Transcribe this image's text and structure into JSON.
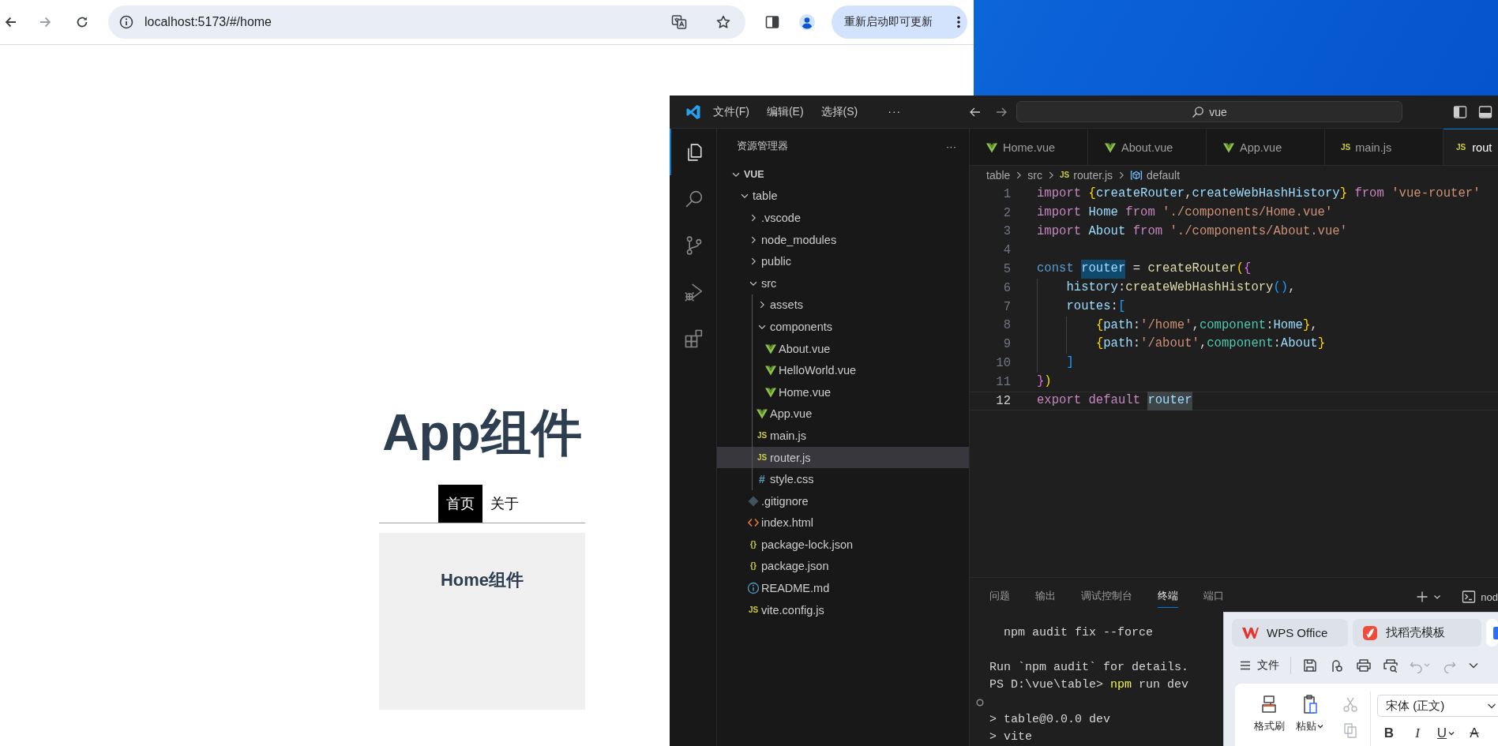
{
  "browser": {
    "url": "localhost:5173/#/home",
    "update_button": "重新启动即可更新",
    "page": {
      "heading": "App组件",
      "nav": [
        {
          "label": "首页",
          "selected": true
        },
        {
          "label": "关于",
          "selected": false
        }
      ],
      "view_title": "Home组件"
    }
  },
  "editor_window": {
    "menu": [
      "文件(F)",
      "编辑(E)",
      "选择(S)",
      "···"
    ],
    "search": "vue",
    "activity_bar": [
      {
        "kind": "explorer",
        "selected": true
      },
      {
        "kind": "search",
        "selected": false
      },
      {
        "kind": "source-control",
        "selected": false
      },
      {
        "kind": "run-debug",
        "selected": false
      },
      {
        "kind": "extensions",
        "selected": false
      }
    ],
    "explorer": {
      "title": "资源管理器",
      "more": "···",
      "tree": [
        {
          "label": "VUE",
          "kind": "folder",
          "expanded": true,
          "selected": false,
          "children": [
            {
              "label": "table",
              "kind": "folder",
              "expanded": true,
              "selected": false,
              "children": [
                {
                  "label": ".vscode",
                  "kind": "folder",
                  "expanded": false,
                  "selected": false
                },
                {
                  "label": "node_modules",
                  "kind": "folder",
                  "expanded": false,
                  "selected": false
                },
                {
                  "label": "public",
                  "kind": "folder",
                  "expanded": false,
                  "selected": false
                },
                {
                  "label": "src",
                  "kind": "folder",
                  "expanded": true,
                  "selected": false,
                  "children": [
                    {
                      "label": "assets",
                      "kind": "folder",
                      "expanded": false,
                      "selected": false
                    },
                    {
                      "label": "components",
                      "kind": "folder",
                      "expanded": true,
                      "selected": false,
                      "children": [
                        {
                          "label": "About.vue",
                          "kind": "vue",
                          "selected": false
                        },
                        {
                          "label": "HelloWorld.vue",
                          "kind": "vue",
                          "selected": false
                        },
                        {
                          "label": "Home.vue",
                          "kind": "vue",
                          "selected": false
                        }
                      ]
                    },
                    {
                      "label": "App.vue",
                      "kind": "vue",
                      "selected": false
                    },
                    {
                      "label": "main.js",
                      "kind": "js",
                      "icon_text": "JS",
                      "selected": false
                    },
                    {
                      "label": "router.js",
                      "kind": "js",
                      "icon_text": "JS",
                      "selected": true
                    },
                    {
                      "label": "style.css",
                      "kind": "css",
                      "icon_text": "#",
                      "selected": false
                    }
                  ]
                },
                {
                  "label": ".gitignore",
                  "kind": "git",
                  "selected": false
                },
                {
                  "label": "index.html",
                  "kind": "html",
                  "selected": false
                },
                {
                  "label": "package-lock.json",
                  "kind": "json",
                  "icon_text": "{}",
                  "selected": false
                },
                {
                  "label": "package.json",
                  "kind": "json",
                  "icon_text": "{}",
                  "selected": false
                },
                {
                  "label": "README.md",
                  "kind": "info",
                  "selected": false
                },
                {
                  "label": "vite.config.js",
                  "kind": "js",
                  "icon_text": "JS",
                  "selected": false
                }
              ]
            }
          ]
        }
      ]
    },
    "tabs": [
      {
        "label": "Home.vue",
        "kind": "vue",
        "selected": false
      },
      {
        "label": "About.vue",
        "kind": "vue",
        "selected": false
      },
      {
        "label": "App.vue",
        "kind": "vue",
        "selected": false
      },
      {
        "label": "main.js",
        "kind": "js",
        "icon_text": "JS",
        "selected": false
      },
      {
        "label": "rout",
        "kind": "js",
        "icon_text": "JS",
        "selected": true
      }
    ],
    "breadcrumb": [
      {
        "label": "table",
        "kind": "folder"
      },
      {
        "label": "src",
        "kind": "folder"
      },
      {
        "label": "router.js",
        "kind": "js",
        "icon_text": "JS"
      },
      {
        "label": "default",
        "kind": "symbol"
      }
    ],
    "code": [
      {
        "number": "1",
        "current": false,
        "tokens": [
          {
            "text": "import ",
            "kind": "kw"
          },
          {
            "text": "{",
            "kind": "b1"
          },
          {
            "text": "createRouter",
            "kind": "var"
          },
          {
            "text": ",",
            "kind": "p"
          },
          {
            "text": "createWebHashHistory",
            "kind": "var"
          },
          {
            "text": "} ",
            "kind": "b1"
          },
          {
            "text": "from ",
            "kind": "kw"
          },
          {
            "text": "'vue-router'",
            "kind": "str"
          }
        ]
      },
      {
        "number": "2",
        "current": false,
        "tokens": [
          {
            "text": "import ",
            "kind": "kw"
          },
          {
            "text": "Home ",
            "kind": "var"
          },
          {
            "text": "from ",
            "kind": "kw"
          },
          {
            "text": "'./components/Home.vue'",
            "kind": "str"
          }
        ]
      },
      {
        "number": "3",
        "current": false,
        "tokens": [
          {
            "text": "import ",
            "kind": "kw"
          },
          {
            "text": "About ",
            "kind": "var"
          },
          {
            "text": "from ",
            "kind": "kw"
          },
          {
            "text": "'./components/About.vue'",
            "kind": "str"
          }
        ]
      },
      {
        "number": "4",
        "current": false
      },
      {
        "number": "5",
        "current": false,
        "tokens": [
          {
            "text": "const ",
            "kind": "storage"
          },
          {
            "text": "router",
            "kind": "var",
            "highlighted": true,
            "write_access": true
          },
          {
            "text": " = ",
            "kind": "p"
          },
          {
            "text": "createRouter",
            "kind": "fn"
          },
          {
            "text": "(",
            "kind": "b1"
          },
          {
            "text": "{",
            "kind": "b2"
          }
        ]
      },
      {
        "number": "6",
        "current": false,
        "tokens": [
          {
            "text": "    history",
            "kind": "var"
          },
          {
            "text": ":",
            "kind": "p"
          },
          {
            "text": "createWebHashHistory",
            "kind": "fn"
          },
          {
            "text": "()",
            "kind": "b3"
          },
          {
            "text": ",",
            "kind": "p"
          }
        ]
      },
      {
        "number": "7",
        "current": false,
        "tokens": [
          {
            "text": "    routes",
            "kind": "var"
          },
          {
            "text": ":",
            "kind": "p"
          },
          {
            "text": "[",
            "kind": "b3"
          }
        ]
      },
      {
        "number": "8",
        "current": false,
        "tokens": [
          {
            "text": "        {",
            "kind": "b1"
          },
          {
            "text": "path",
            "kind": "var"
          },
          {
            "text": ":",
            "kind": "p"
          },
          {
            "text": "'/home'",
            "kind": "str"
          },
          {
            "text": ",",
            "kind": "p"
          },
          {
            "text": "component",
            "kind": "type"
          },
          {
            "text": ":",
            "kind": "p"
          },
          {
            "text": "Home",
            "kind": "var"
          },
          {
            "text": "}",
            "kind": "b1"
          },
          {
            "text": ",",
            "kind": "p"
          }
        ]
      },
      {
        "number": "9",
        "current": false,
        "tokens": [
          {
            "text": "        {",
            "kind": "b1"
          },
          {
            "text": "path",
            "kind": "var"
          },
          {
            "text": ":",
            "kind": "p"
          },
          {
            "text": "'/about'",
            "kind": "str"
          },
          {
            "text": ",",
            "kind": "p"
          },
          {
            "text": "component",
            "kind": "type"
          },
          {
            "text": ":",
            "kind": "p"
          },
          {
            "text": "About",
            "kind": "var"
          },
          {
            "text": "}",
            "kind": "b1"
          }
        ]
      },
      {
        "number": "10",
        "current": false,
        "tokens": [
          {
            "text": "    ]",
            "kind": "b3"
          }
        ]
      },
      {
        "number": "11",
        "current": false,
        "tokens": [
          {
            "text": "}",
            "kind": "b2"
          },
          {
            "text": ")",
            "kind": "b1"
          }
        ]
      },
      {
        "number": "12",
        "current": true,
        "tokens": [
          {
            "text": "export ",
            "kind": "kw"
          },
          {
            "text": "default ",
            "kind": "kw"
          },
          {
            "text": "router",
            "kind": "var",
            "highlighted": true,
            "write_access": false
          }
        ]
      }
    ],
    "panel": {
      "tabs": [
        {
          "label": "问题",
          "selected": false
        },
        {
          "label": "输出",
          "selected": false
        },
        {
          "label": "调试控制台",
          "selected": false
        },
        {
          "label": "终端",
          "selected": true
        },
        {
          "label": "端口",
          "selected": false
        }
      ],
      "terminal_profile": "nod",
      "terminal": [
        {
          "kind": "text",
          "tokens": [
            {
              "text": "  npm audit fix --force",
              "kind": "p"
            }
          ]
        },
        {
          "kind": "blank"
        },
        {
          "kind": "text",
          "tokens": [
            {
              "text": "Run `npm audit` for details.",
              "kind": "p"
            }
          ]
        },
        {
          "kind": "text",
          "tokens": [
            {
              "text": "PS D:\\vue\\table> ",
              "kind": "p"
            },
            {
              "text": "npm",
              "kind": "cmd"
            },
            {
              "text": " run dev",
              "kind": "p"
            }
          ]
        },
        {
          "kind": "marker"
        },
        {
          "kind": "text",
          "tokens": [
            {
              "text": "> table@0.0.0 dev",
              "kind": "p"
            }
          ]
        },
        {
          "kind": "text",
          "tokens": [
            {
              "text": "> vite",
              "kind": "p"
            }
          ]
        }
      ]
    }
  },
  "wps_window": {
    "tabs": [
      {
        "label": "WPS Office",
        "kind": "wps",
        "selected": false
      },
      {
        "label": "找稻壳模板",
        "kind": "docer",
        "selected": false
      },
      {
        "kind": "document",
        "selected": true
      }
    ],
    "menu": "文件",
    "ribbon": {
      "format_painter": "格式刷",
      "paste": "粘贴",
      "font": "宋体 (正文)",
      "format_buttons": [
        {
          "label": "B",
          "kind": "bold",
          "dropdown": false
        },
        {
          "label": "I",
          "kind": "italic",
          "dropdown": false
        },
        {
          "label": "U",
          "kind": "underline",
          "dropdown": true
        },
        {
          "label": "A",
          "kind": "strikethrough",
          "dropdown": false
        }
      ]
    }
  }
}
